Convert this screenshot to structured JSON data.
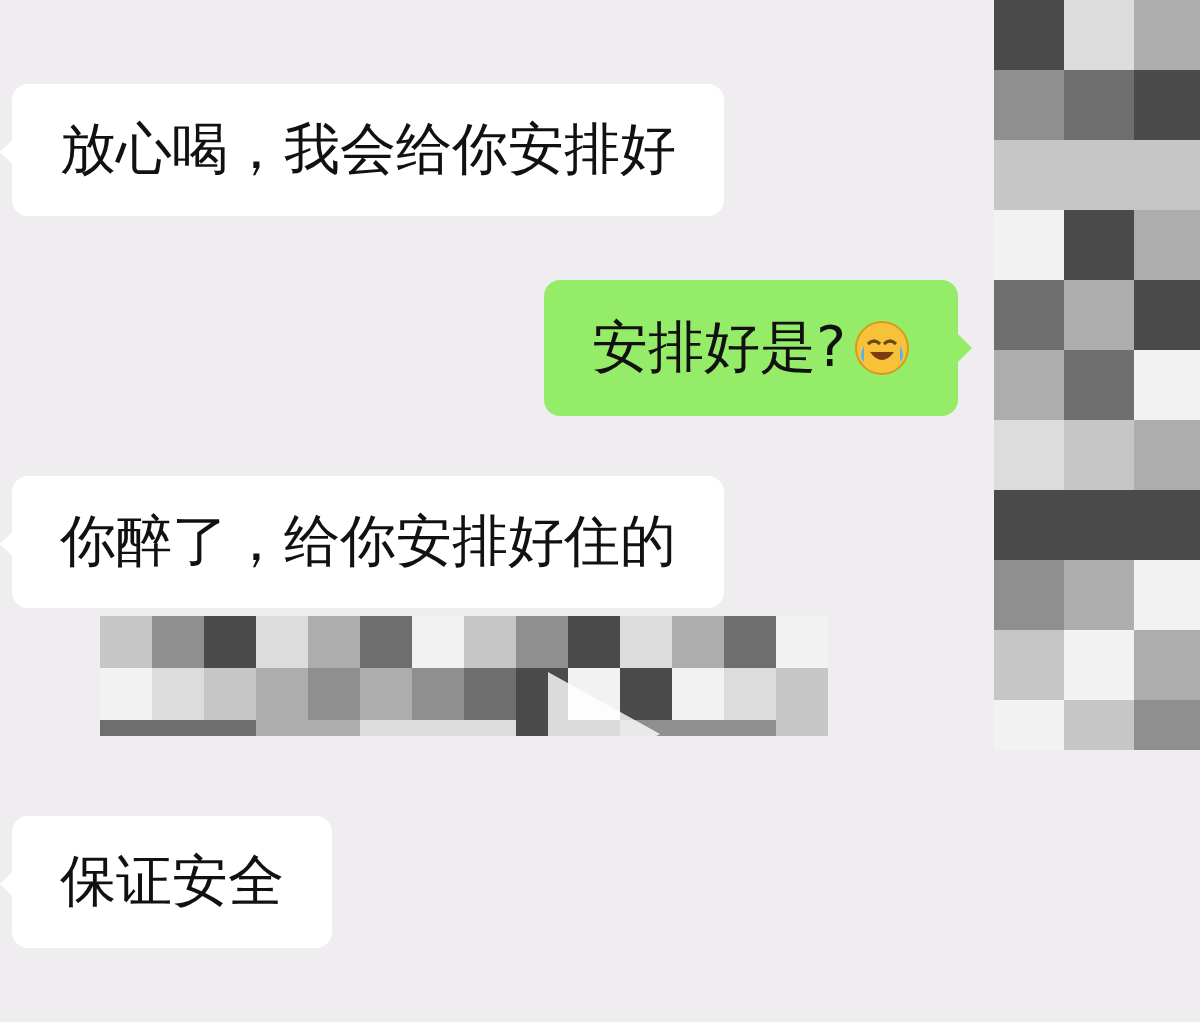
{
  "messages": [
    {
      "kind": "received",
      "text": "放心喝，我会给你安排好"
    },
    {
      "kind": "sent",
      "text": "安排好是?",
      "emoji": true
    },
    {
      "kind": "received",
      "text": "你醉了，给你安排好住的"
    },
    {
      "kind": "picture",
      "play": true
    },
    {
      "kind": "received",
      "text": "保证安全"
    }
  ],
  "side_panel": {
    "kind": "picture"
  }
}
